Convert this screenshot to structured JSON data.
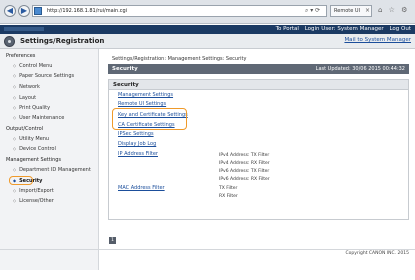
{
  "browser": {
    "url": "http://192.168.1.81/rui/main.cgi",
    "tab_title": "Remote UI",
    "back_glyph": "◀",
    "forward_glyph": "▶",
    "tools_glyphs": "⌕ ▾ ⟳",
    "tab_close_glyph": "×",
    "right_icons": "⌂ ☆ ⚙"
  },
  "top_bar": {
    "to_portal": "To Portal",
    "login_user": "Login User: System Manager",
    "log_out": "Log Out"
  },
  "header": {
    "title": "Settings/Registration",
    "mail_link": "Mail to System Manager"
  },
  "sidebar": {
    "preferences": "Preferences",
    "preferences_items": [
      "Control Menu",
      "Paper Source Settings",
      "Network",
      "Layout",
      "Print Quality",
      "User Maintenance"
    ],
    "output_control": "Output/Control",
    "output_items": [
      "Utility Menu",
      "Device Control"
    ],
    "management": "Management Settings",
    "management_items": [
      "Department ID Management",
      "Security",
      "Import/Export",
      "License/Other"
    ]
  },
  "main": {
    "breadcrumb": "Settings/Registration: Management Settings: Security",
    "page_title": "Security",
    "last_updated": "Last Updated: 30/06 2015 00:44:32",
    "section_title": "Security",
    "links": [
      "Management Settings",
      "Remote UI Settings",
      "Key and Certificate Settings",
      "CA Certificate Settings",
      "IPSec Settings",
      "Display Job Log",
      "IP Address Filter",
      "MAC Address Filter"
    ],
    "ip_filters": [
      "IPv4 Address: TX Filter",
      "IPv4 Address: RX Filter",
      "IPv6 Address: TX Filter",
      "IPv6 Address: RX Filter"
    ],
    "mac_filters": [
      "TX Filter",
      "RX Filter"
    ],
    "page_number": "1"
  },
  "footer": {
    "copyright": "Copyright CANON INC. 2015"
  },
  "colors": {
    "highlight": "#ef9a2a",
    "top_bar": "#1b3a63",
    "link": "#1b4e9b"
  }
}
